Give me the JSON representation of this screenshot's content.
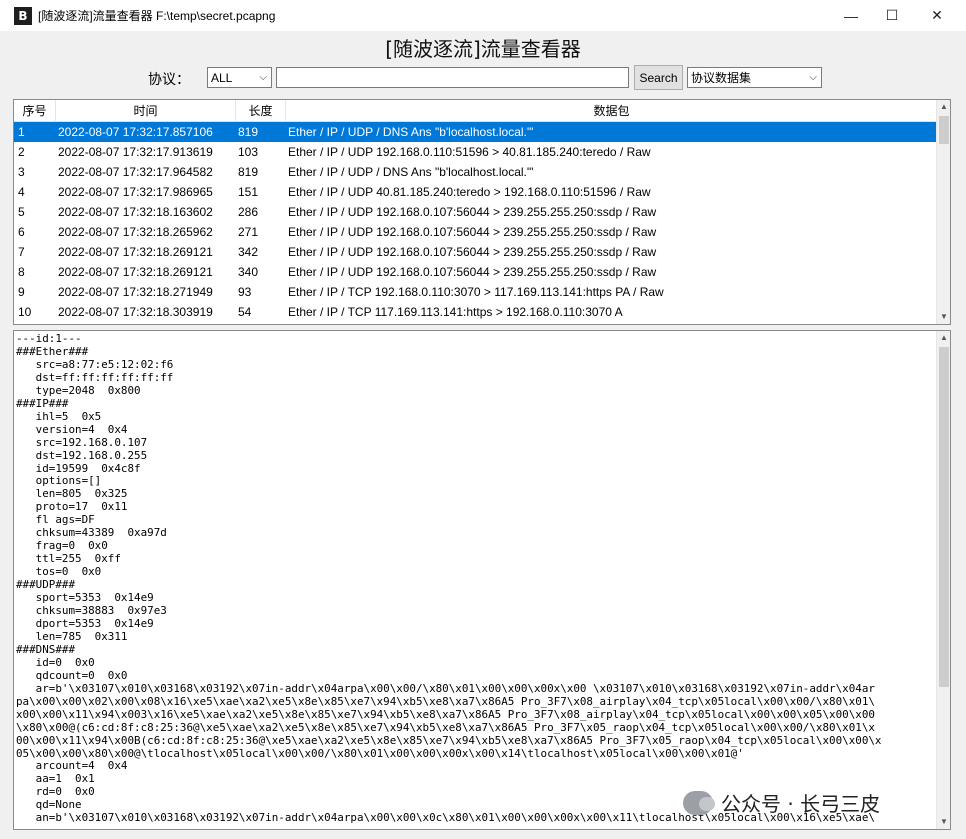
{
  "window": {
    "icon_text": "B",
    "title": "[随波逐流]流量查看器  F:\\temp\\secret.pcapng",
    "minimize": "—",
    "maximize": "☐",
    "close": "✕"
  },
  "heading": "[随波逐流]流量查看器",
  "toolbar": {
    "protocol_label": "协议：",
    "protocol_value": "ALL",
    "filter_value": "",
    "search_label": "Search",
    "dataset_value": "协议数据集"
  },
  "packet_list": {
    "columns": [
      "序号",
      "时间",
      "长度",
      "数据包"
    ],
    "rows": [
      {
        "no": "1",
        "time": "2022-08-07 17:32:17.857106",
        "len": "819",
        "packet": "Ether / IP / UDP / DNS Ans \"b'localhost.local.'\""
      },
      {
        "no": "2",
        "time": "2022-08-07 17:32:17.913619",
        "len": "103",
        "packet": "Ether / IP / UDP 192.168.0.110:51596 > 40.81.185.240:teredo / Raw"
      },
      {
        "no": "3",
        "time": "2022-08-07 17:32:17.964582",
        "len": "819",
        "packet": "Ether / IP / UDP / DNS Ans \"b'localhost.local.'\""
      },
      {
        "no": "4",
        "time": "2022-08-07 17:32:17.986965",
        "len": "151",
        "packet": "Ether / IP / UDP 40.81.185.240:teredo > 192.168.0.110:51596 / Raw"
      },
      {
        "no": "5",
        "time": "2022-08-07 17:32:18.163602",
        "len": "286",
        "packet": "Ether / IP / UDP 192.168.0.107:56044 > 239.255.255.250:ssdp / Raw"
      },
      {
        "no": "6",
        "time": "2022-08-07 17:32:18.265962",
        "len": "271",
        "packet": "Ether / IP / UDP 192.168.0.107:56044 > 239.255.255.250:ssdp / Raw"
      },
      {
        "no": "7",
        "time": "2022-08-07 17:32:18.269121",
        "len": "342",
        "packet": "Ether / IP / UDP 192.168.0.107:56044 > 239.255.255.250:ssdp / Raw"
      },
      {
        "no": "8",
        "time": "2022-08-07 17:32:18.269121",
        "len": "340",
        "packet": "Ether / IP / UDP 192.168.0.107:56044 > 239.255.255.250:ssdp / Raw"
      },
      {
        "no": "9",
        "time": "2022-08-07 17:32:18.271949",
        "len": "93",
        "packet": "Ether / IP / TCP 192.168.0.110:3070 > 117.169.113.141:https PA / Raw"
      },
      {
        "no": "10",
        "time": "2022-08-07 17:32:18.303919",
        "len": "54",
        "packet": "Ether / IP / TCP 117.169.113.141:https > 192.168.0.110:3070 A"
      }
    ],
    "selected_index": 0
  },
  "detail": {
    "lines": [
      "---id:1---",
      "###Ether###",
      "   src=a8:77:e5:12:02:f6",
      "   dst=ff:ff:ff:ff:ff:ff",
      "   type=2048  0x800",
      "###IP###",
      "   ihl=5  0x5",
      "   version=4  0x4",
      "   src=192.168.0.107",
      "   dst=192.168.0.255",
      "   id=19599  0x4c8f",
      "   options=[]",
      "   len=805  0x325",
      "   proto=17  0x11",
      "   fl ags=DF",
      "   chksum=43389  0xa97d",
      "   frag=0  0x0",
      "   ttl=255  0xff",
      "   tos=0  0x0",
      "###UDP###",
      "   sport=5353  0x14e9",
      "   chksum=38883  0x97e3",
      "   dport=5353  0x14e9",
      "   len=785  0x311",
      "###DNS###",
      "   id=0  0x0",
      "   qdcount=0  0x0",
      "   ar=b'\\x03107\\x010\\x03168\\x03192\\x07in-addr\\x04arpa\\x00\\x00/\\x80\\x01\\x00\\x00\\x00x\\x00 \\x03107\\x010\\x03168\\x03192\\x07in-addr\\x04ar",
      "pa\\x00\\x00\\x02\\x00\\x08\\x16\\xe5\\xae\\xa2\\xe5\\x8e\\x85\\xe7\\x94\\xb5\\xe8\\xa7\\x86A5 Pro_3F7\\x08_airplay\\x04_tcp\\x05local\\x00\\x00/\\x80\\x01\\",
      "x00\\x00\\x11\\x94\\x003\\x16\\xe5\\xae\\xa2\\xe5\\x8e\\x85\\xe7\\x94\\xb5\\xe8\\xa7\\x86A5 Pro_3F7\\x08_airplay\\x04_tcp\\x05local\\x00\\x00\\x05\\x00\\x00",
      "\\x80\\x00@(c6:cd:8f:c8:25:36@\\xe5\\xae\\xa2\\xe5\\x8e\\x85\\xe7\\x94\\xb5\\xe8\\xa7\\x86A5 Pro_3F7\\x05_raop\\x04_tcp\\x05local\\x00\\x00/\\x80\\x01\\x",
      "00\\x00\\x11\\x94\\x00B(c6:cd:8f:c8:25:36@\\xe5\\xae\\xa2\\xe5\\x8e\\x85\\xe7\\x94\\xb5\\xe8\\xa7\\x86A5 Pro_3F7\\x05_raop\\x04_tcp\\x05local\\x00\\x00\\x",
      "05\\x00\\x00\\x80\\x00@\\tlocalhost\\x05local\\x00\\x00/\\x80\\x01\\x00\\x00\\x00x\\x00\\x14\\tlocalhost\\x05local\\x00\\x00\\x01@'",
      "   arcount=4  0x4",
      "   aa=1  0x1",
      "   rd=0  0x0",
      "   qd=None",
      "   an=b'\\x03107\\x010\\x03168\\x03192\\x07in-addr\\x04arpa\\x00\\x00\\x0c\\x80\\x01\\x00\\x00\\x00x\\x00\\x11\\tlocalhost\\x05local\\x00\\x16\\xe5\\xae\\"
    ]
  },
  "watermark": "公众号 · 长弓三皮"
}
